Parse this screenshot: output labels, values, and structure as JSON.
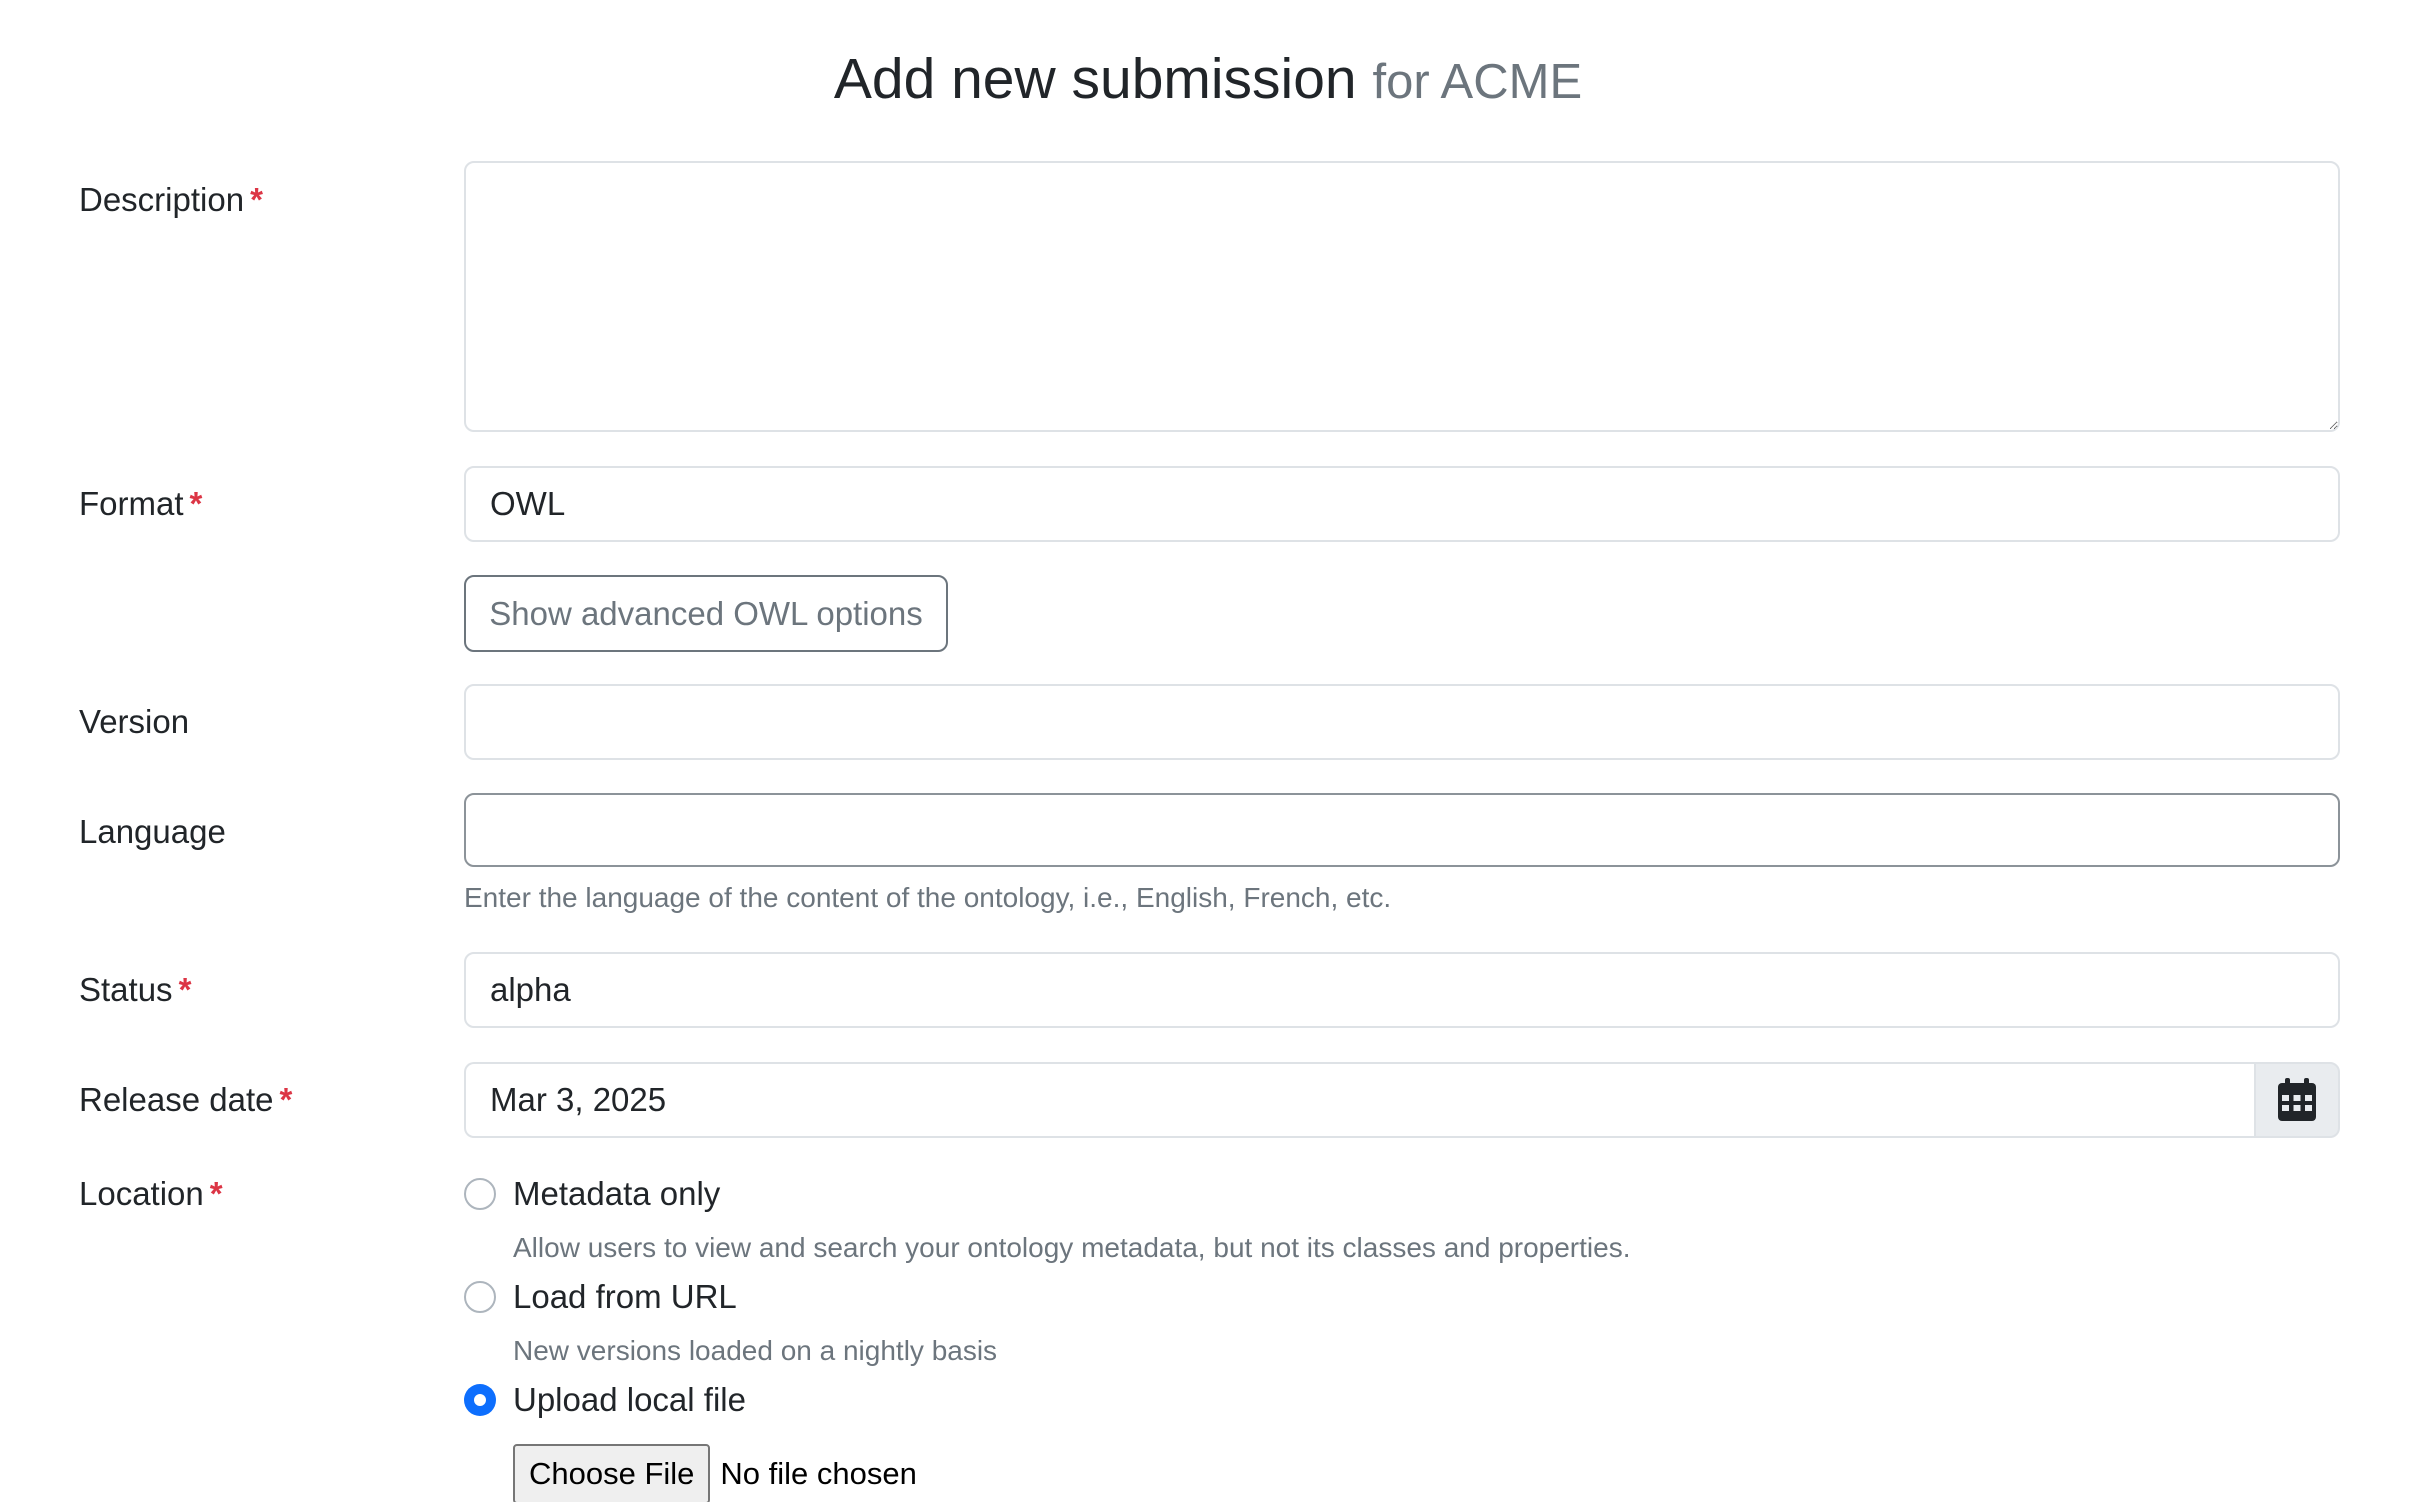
{
  "header": {
    "title": "Add new submission",
    "subtitle": "for ACME"
  },
  "form": {
    "required_marker": "*",
    "description": {
      "label": "Description",
      "value": ""
    },
    "format": {
      "label": "Format",
      "value": "OWL",
      "advanced_button": "Show advanced OWL options"
    },
    "version": {
      "label": "Version",
      "value": ""
    },
    "language": {
      "label": "Language",
      "value": "",
      "help": "Enter the language of the content of the ontology, i.e., English, French, etc."
    },
    "status": {
      "label": "Status",
      "value": "alpha"
    },
    "release_date": {
      "label": "Release date",
      "value": "Mar 3, 2025",
      "calendar_icon": "calendar-icon"
    },
    "location": {
      "label": "Location",
      "selected": "Upload local file",
      "options": [
        {
          "label": "Metadata only",
          "help": "Allow users to view and search your ontology metadata, but not its classes and properties.",
          "checked": false
        },
        {
          "label": "Load from URL",
          "help": "New versions loaded on a nightly basis",
          "checked": false
        },
        {
          "label": "Upload local file",
          "checked": true
        }
      ],
      "file": {
        "button": "Choose File",
        "status": "No file chosen"
      }
    }
  },
  "colors": {
    "accent": "#0d6efd",
    "required": "#dc3545",
    "muted_text": "#6c757d",
    "border": "#dee2e6"
  }
}
